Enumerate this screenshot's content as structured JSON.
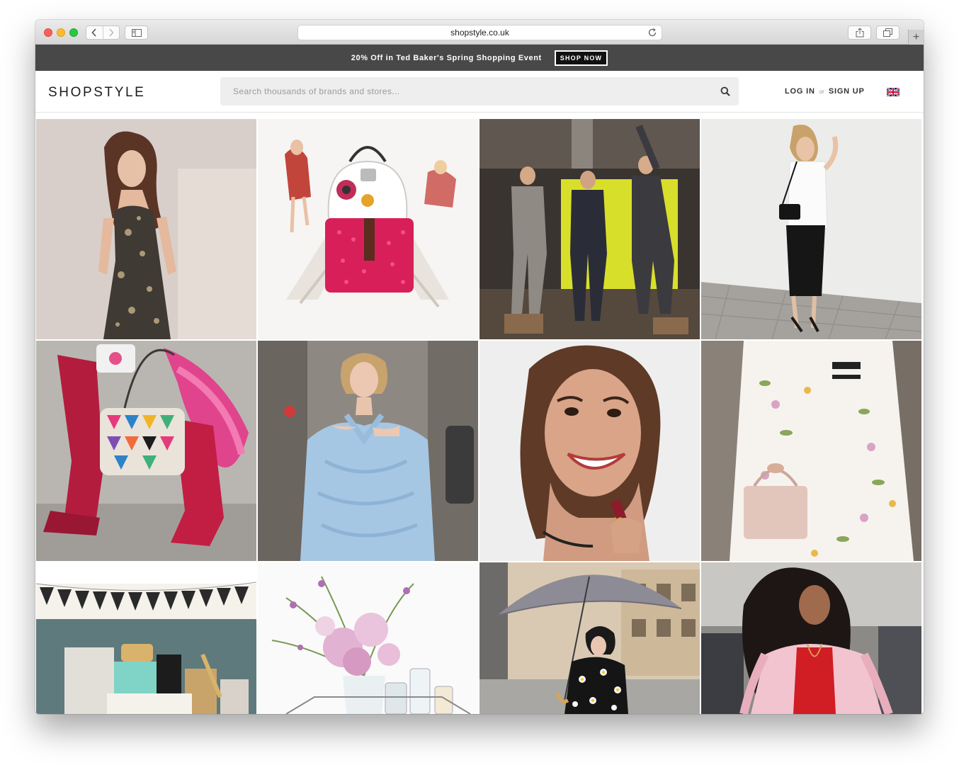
{
  "browser": {
    "url": "shopstyle.co.uk",
    "icons": {
      "back": "chevron-left-icon",
      "forward": "chevron-right-icon",
      "sidebar": "sidebar-icon",
      "reload": "reload-icon",
      "share": "share-icon",
      "tabs": "tab-overview-icon",
      "new_tab": "plus-icon"
    },
    "new_tab_label": "+"
  },
  "promo": {
    "text": "20% Off in Ted Baker's Spring Shopping Event",
    "button_label": "SHOP NOW"
  },
  "header": {
    "logo": "SHOPSTYLE",
    "search_placeholder": "Search thousands of brands and stores...",
    "login_label": "LOG IN",
    "or_label": "or",
    "signup_label": "SIGN UP",
    "flag": "uk-flag-icon"
  },
  "tiles": [
    {
      "name": "floral-dress-model-photo"
    },
    {
      "name": "pink-studded-handbag-illustration-photo"
    },
    {
      "name": "three-men-in-suits-photo"
    },
    {
      "name": "white-top-black-culottes-photo"
    },
    {
      "name": "pink-boots-patterned-bag-photo"
    },
    {
      "name": "blue-ruffle-top-photo"
    },
    {
      "name": "smiling-woman-lipstick-photo"
    },
    {
      "name": "floral-kimono-tote-photo"
    },
    {
      "name": "gift-boxes-bunting-photo"
    },
    {
      "name": "peony-bouquet-perfume-photo"
    },
    {
      "name": "woman-with-umbrella-photo"
    },
    {
      "name": "pink-fur-coat-photo"
    }
  ],
  "colors": {
    "promo_bg": "#484848",
    "search_bg": "#eeeeee",
    "traffic_red": "#fc5f57",
    "traffic_yellow": "#fdbc2e",
    "traffic_green": "#28c840"
  }
}
